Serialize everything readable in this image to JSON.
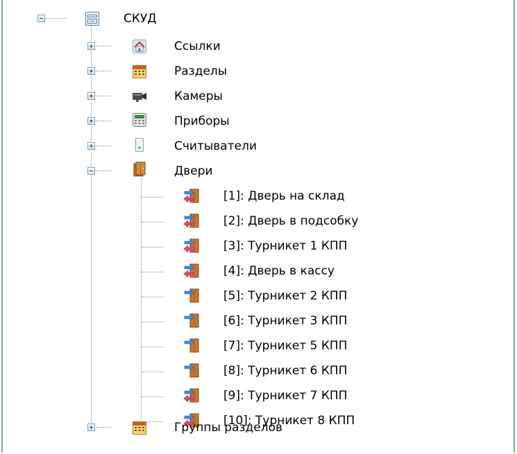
{
  "tree": {
    "root": {
      "label": "СКУД",
      "icon": "panel-icon",
      "expanded": true
    },
    "children": [
      {
        "label": "Ссылки",
        "icon": "house-icon",
        "expanded": false
      },
      {
        "label": "Разделы",
        "icon": "calendar-icon",
        "expanded": false
      },
      {
        "label": "Камеры",
        "icon": "camera-icon",
        "expanded": false
      },
      {
        "label": "Приборы",
        "icon": "device-icon",
        "expanded": false
      },
      {
        "label": "Считыватели",
        "icon": "reader-icon",
        "expanded": false
      },
      {
        "label": "Двери",
        "icon": "door-folder-icon",
        "expanded": true
      },
      {
        "label": "Группы разделов",
        "icon": "calendar-icon",
        "expanded": false
      }
    ],
    "doors": [
      {
        "label": "[1]: Дверь  на склад",
        "icon": "door-in-out-icon"
      },
      {
        "label": "[2]: Дверь в подсобку",
        "icon": "door-in-out-icon"
      },
      {
        "label": "[3]: Турникет 1 КПП",
        "icon": "door-in-out-icon"
      },
      {
        "label": "[4]: Дверь в кассу",
        "icon": "door-in-out-icon"
      },
      {
        "label": "[5]: Турникет 2 КПП",
        "icon": "door-in-icon"
      },
      {
        "label": "[6]: Турникет 3 КПП",
        "icon": "door-in-icon"
      },
      {
        "label": "[7]: Турникет 5 КПП",
        "icon": "door-in-icon"
      },
      {
        "label": "[8]: Турникет 6 КПП",
        "icon": "door-in-icon"
      },
      {
        "label": "[9]: Турникет 7 КПП",
        "icon": "door-in-out-icon"
      },
      {
        "label": "[10]: Турникет 8 КПП",
        "icon": "door-in-out-icon"
      }
    ]
  }
}
